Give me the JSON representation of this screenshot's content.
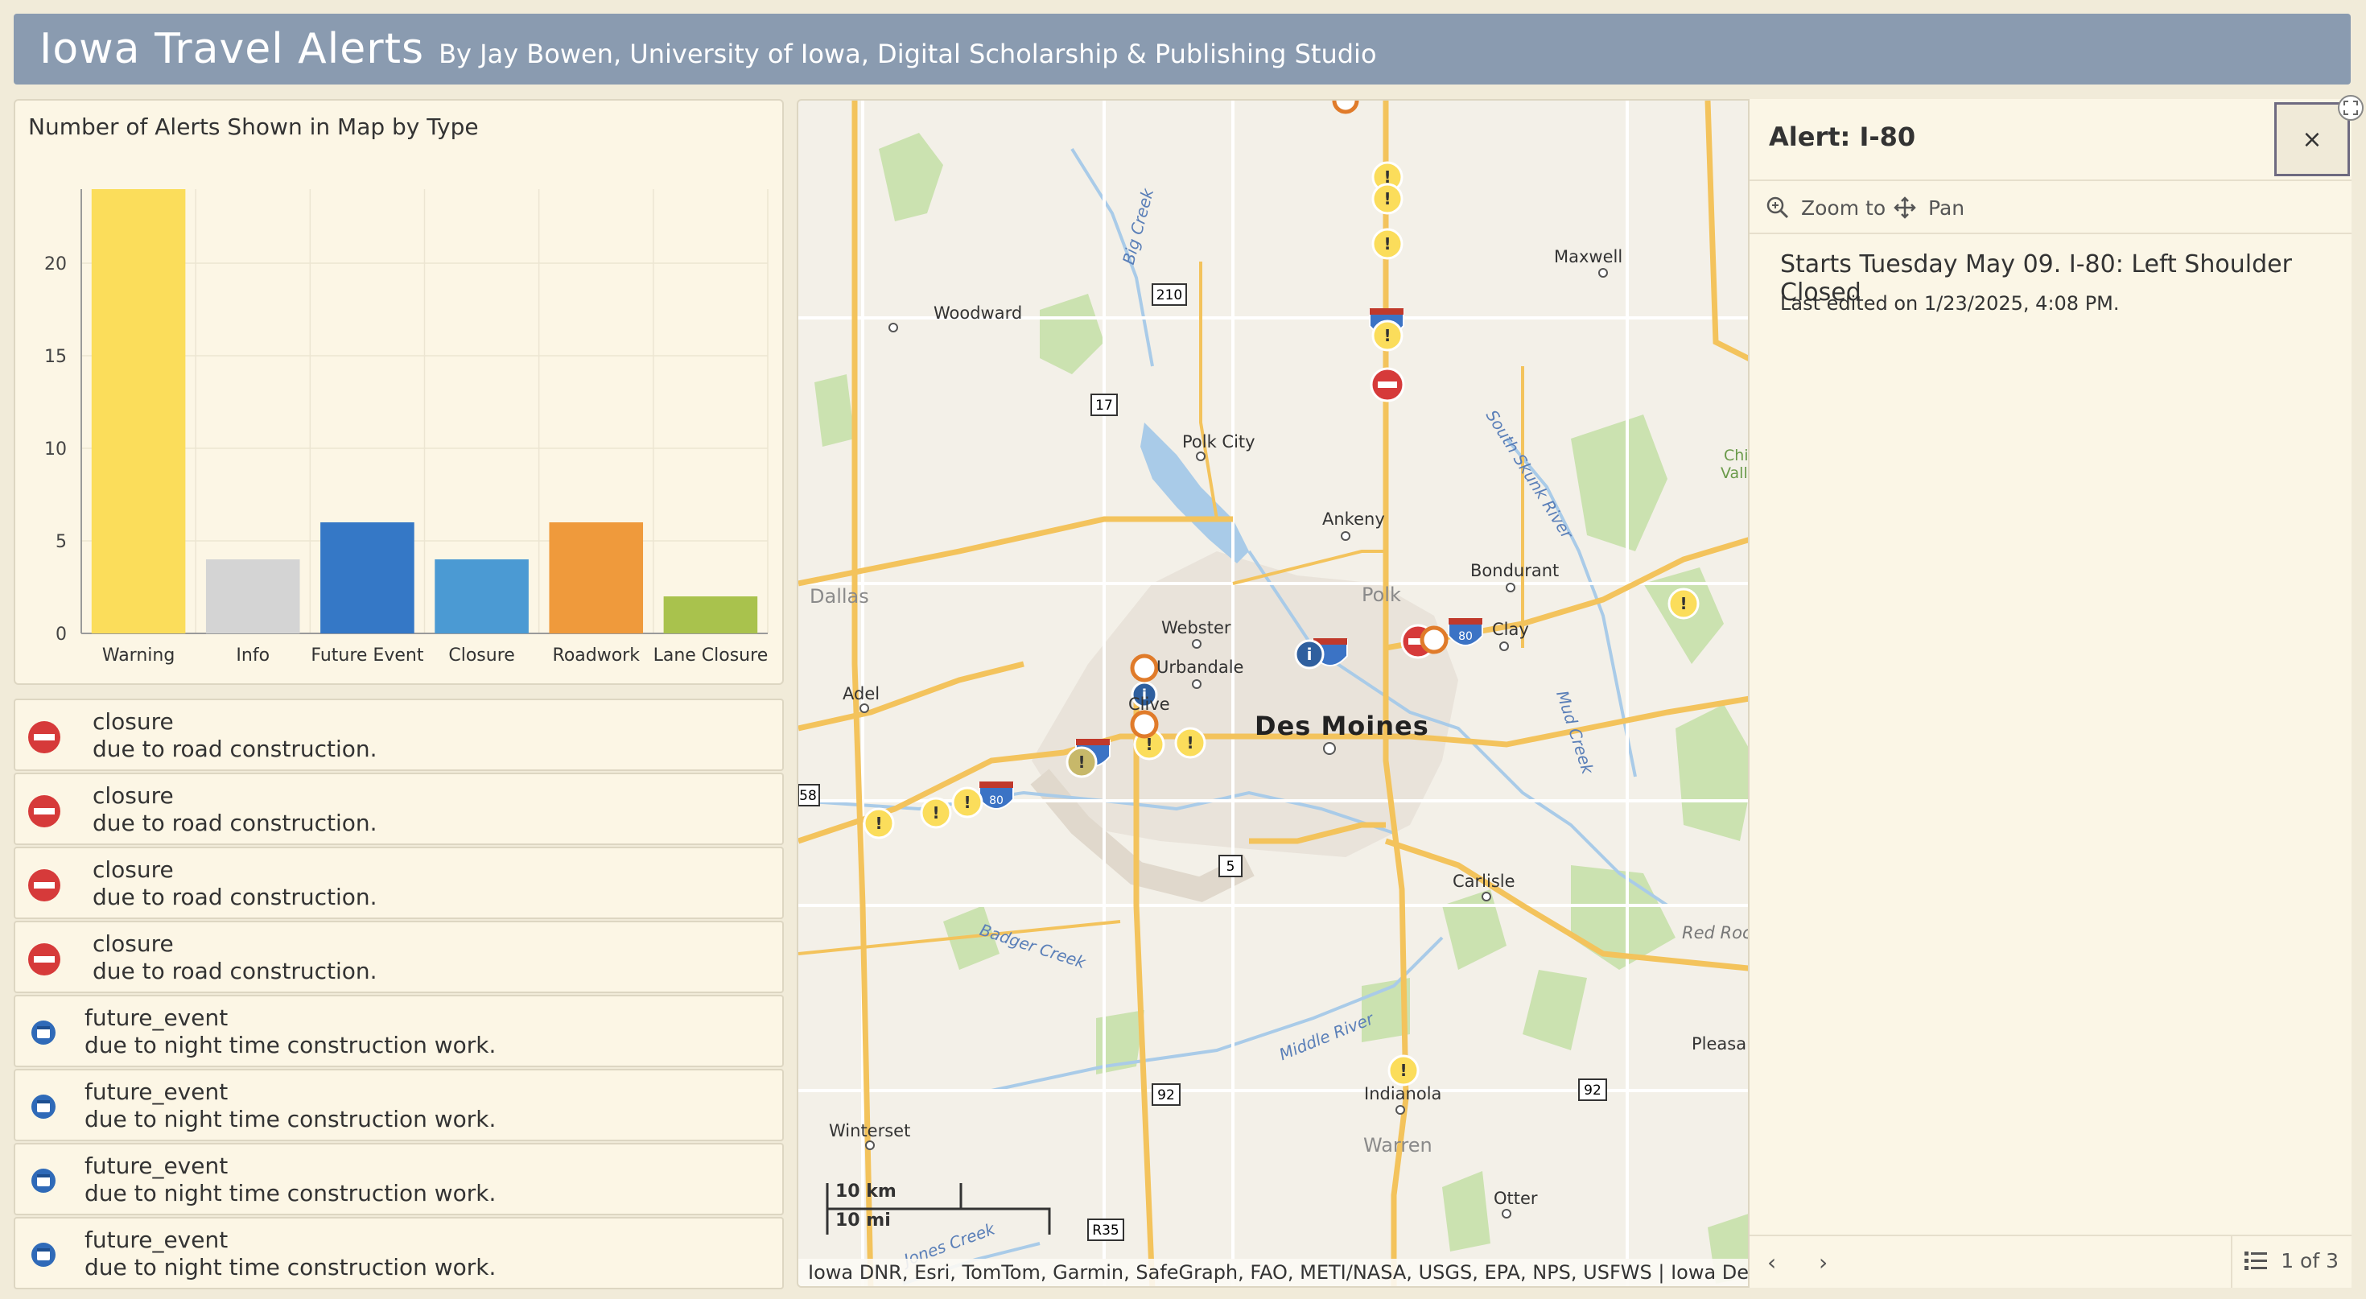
{
  "header": {
    "title": "Iowa Travel Alerts",
    "subtitle": "By Jay Bowen, University of Iowa, Digital Scholarship & Publishing Studio"
  },
  "chart_panel": {
    "title": "Number of Alerts Shown in Map by Type"
  },
  "chart_data": {
    "type": "bar",
    "title": "Number of Alerts Shown in Map by Type",
    "categories": [
      "Warning",
      "Info",
      "Future Event",
      "Closure",
      "Roadwork",
      "Lane Closure"
    ],
    "values": [
      24,
      4,
      6,
      4,
      6,
      2
    ],
    "colors": [
      "#fbdd5b",
      "#d4d4d4",
      "#3578c6",
      "#4b9ad3",
      "#ef9a3c",
      "#a9c24d"
    ],
    "ylim": [
      0,
      24
    ],
    "yticks": [
      0,
      5,
      10,
      15,
      20
    ],
    "grid": true,
    "xlabel": "",
    "ylabel": ""
  },
  "alert_list": [
    {
      "type": "closure",
      "line1": "closure",
      "line2": "due to road construction."
    },
    {
      "type": "closure",
      "line1": "closure",
      "line2": "due to road construction."
    },
    {
      "type": "closure",
      "line1": "closure",
      "line2": "due to road construction."
    },
    {
      "type": "closure",
      "line1": "closure",
      "line2": "due to road construction."
    },
    {
      "type": "future_event",
      "line1": "future_event",
      "line2": "due to night time construction work."
    },
    {
      "type": "future_event",
      "line1": "future_event",
      "line2": "due to night time construction work."
    },
    {
      "type": "future_event",
      "line1": "future_event",
      "line2": "due to night time construction work."
    },
    {
      "type": "future_event",
      "line1": "future_event",
      "line2": "due to night time construction work."
    }
  ],
  "map": {
    "places": {
      "woodward": "Woodward",
      "maxwell": "Maxwell",
      "polk_city": "Polk City",
      "ankeny": "Ankeny",
      "bondurant": "Bondurant",
      "dallas": "Dallas",
      "polk": "Polk",
      "webster": "Webster",
      "urbandale": "Urbandale",
      "clay": "Clay",
      "adel": "Adel",
      "clive": "Clive",
      "des_moines": "Des Moines",
      "carlisle": "Carlisle",
      "red_rock": "Red Roc",
      "pleasa": "Pleasa",
      "indianola": "Indianola",
      "winterset": "Winterset",
      "warren": "Warren",
      "otter": "Otter",
      "chi": "Chi",
      "vall": "Vall"
    },
    "water": {
      "big_creek": "Big Creek",
      "south_skunk": "South Skunk River",
      "mud_creek": "Mud Creek",
      "badger_creek": "Badger Creek",
      "middle_river": "Middle River",
      "jones_creek": "Jones Creek"
    },
    "shields": {
      "r210": "210",
      "r17": "17",
      "r5": "5",
      "r92a": "92",
      "r92b": "92",
      "r58": "58",
      "r35": "R35",
      "i80": "80",
      "i80b": "80"
    },
    "scale": {
      "km": "10 km",
      "mi": "10 mi"
    },
    "attribution": "Iowa DNR, Esri, TomTom, Garmin, SafeGraph, FAO, METI/NASA, USGS, EPA, NPS, USFWS | Iowa Department"
  },
  "popup": {
    "title": "Alert: I-80",
    "close_label": "×",
    "zoom_to": "Zoom to",
    "pan": "Pan",
    "content": "Starts Tuesday May 09. I-80: Left Shoulder Closed",
    "edited": "Last edited on 1/23/2025, 4:08 PM.",
    "prev": "‹",
    "next": "›",
    "pager": "1 of 3"
  }
}
